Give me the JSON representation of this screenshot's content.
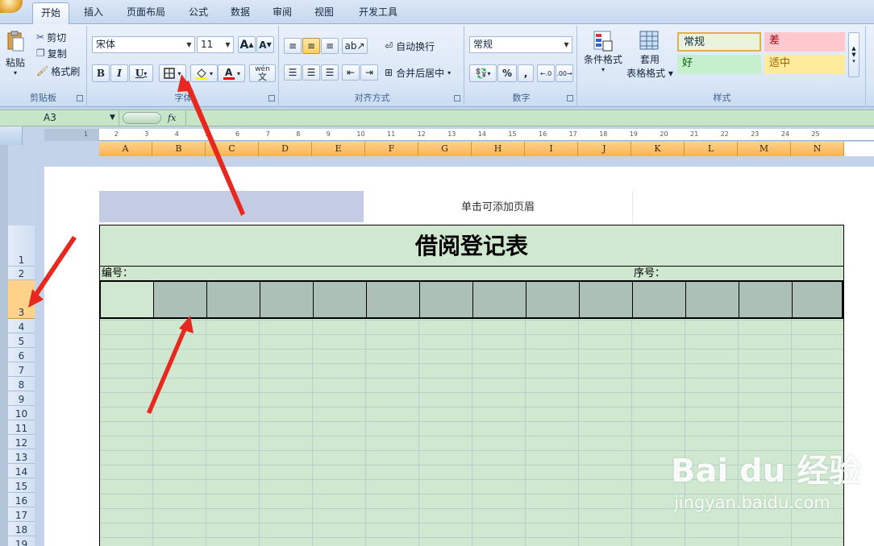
{
  "tabs": [
    "开始",
    "插入",
    "页面布局",
    "公式",
    "数据",
    "审阅",
    "视图",
    "开发工具"
  ],
  "active_tab": "开始",
  "clipboard": {
    "paste": "粘贴",
    "cut": "剪切",
    "copy": "复制",
    "format_painter": "格式刷",
    "label": "剪贴板"
  },
  "font": {
    "name": "宋体",
    "size": "11",
    "bold": "B",
    "italic": "I",
    "underline": "U",
    "grow": "A",
    "shrink": "A",
    "label": "字体",
    "phonetic": "wén"
  },
  "alignment": {
    "wrap": "自动换行",
    "merge": "合并后居中",
    "label": "对齐方式"
  },
  "number": {
    "format": "常规",
    "percent": "%",
    "comma": ",",
    "label": "数字"
  },
  "styles": {
    "conditional": "条件格式",
    "table_format_1": "套用",
    "table_format_2": "表格格式",
    "normal": "常规",
    "bad": "差",
    "good": "好",
    "neutral": "适中",
    "label": "样式"
  },
  "formula_bar": {
    "cell": "A3",
    "fx": "fx"
  },
  "columns": [
    "A",
    "B",
    "C",
    "D",
    "E",
    "F",
    "G",
    "H",
    "I",
    "J",
    "K",
    "L",
    "M",
    "N"
  ],
  "rows": [
    "1",
    "2",
    "3",
    "4",
    "5",
    "6",
    "7",
    "8",
    "9",
    "10",
    "11",
    "12",
    "13",
    "14",
    "15",
    "16",
    "17",
    "18",
    "19"
  ],
  "ruler_numbers": [
    "1",
    "2",
    "3",
    "4",
    "5",
    "6",
    "7",
    "8",
    "9",
    "10",
    "11",
    "12",
    "13",
    "14",
    "15",
    "16",
    "17",
    "18",
    "19",
    "20",
    "21",
    "22",
    "23",
    "24",
    "25"
  ],
  "header_placeholder": "单击可添加页眉",
  "sheet": {
    "title": "借阅登记表",
    "label_left": "编号：",
    "label_right": "序号："
  },
  "watermark": {
    "brand": "Bai du 经验",
    "url": "jingyan.baidu.com"
  },
  "colors": {
    "sheet_green": "#cfe8cf",
    "selected_gray": "#acc0b8",
    "header_orange": "#f6b453",
    "arrow_red": "#e8281e"
  }
}
